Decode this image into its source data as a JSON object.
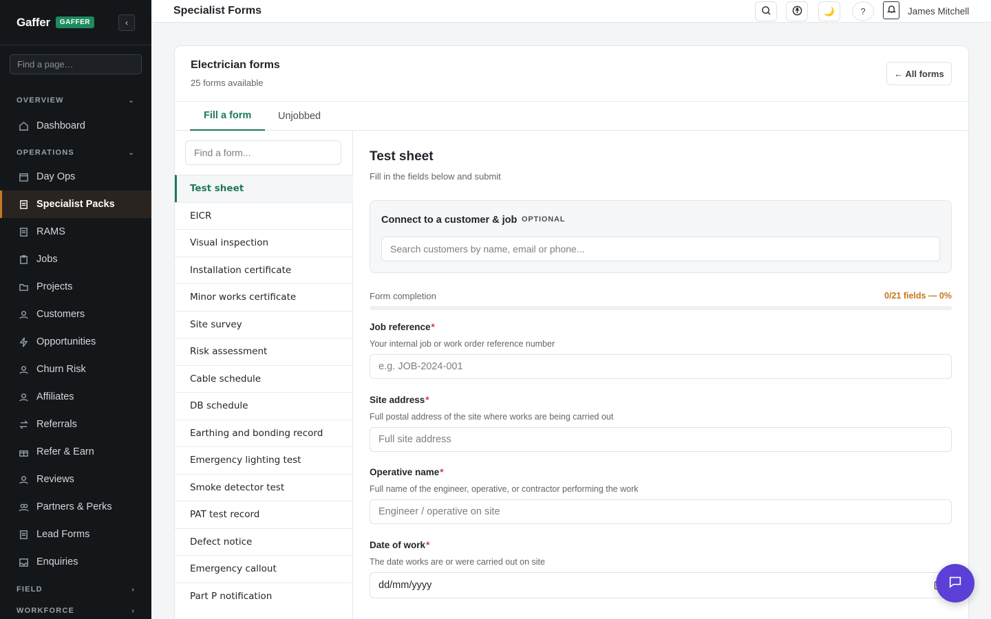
{
  "sidebar": {
    "brand": "Gaffer",
    "badge": "GAFFER",
    "collapse_label": "‹",
    "search_placeholder": "Find a page…",
    "sections": {
      "overview": "OVERVIEW",
      "operations": "OPERATIONS",
      "field": "FIELD",
      "workforce": "WORKFORCE"
    },
    "items": [
      {
        "label": "Dashboard",
        "icon": "home-icon"
      },
      {
        "label": "Day Ops",
        "icon": "calendar-icon"
      },
      {
        "label": "Specialist Packs",
        "icon": "document-icon"
      },
      {
        "label": "RAMS",
        "icon": "document-icon"
      },
      {
        "label": "Jobs",
        "icon": "clipboard-icon"
      },
      {
        "label": "Projects",
        "icon": "folder-icon"
      },
      {
        "label": "Customers",
        "icon": "users-icon"
      },
      {
        "label": "Opportunities",
        "icon": "bolt-icon"
      },
      {
        "label": "Churn Risk",
        "icon": "user-icon"
      },
      {
        "label": "Affiliates",
        "icon": "user-icon"
      },
      {
        "label": "Referrals",
        "icon": "arrows-icon"
      },
      {
        "label": "Refer & Earn",
        "icon": "gift-icon"
      },
      {
        "label": "Reviews",
        "icon": "user-icon"
      },
      {
        "label": "Partners & Perks",
        "icon": "users-icon"
      },
      {
        "label": "Lead Forms",
        "icon": "document-icon"
      },
      {
        "label": "Enquiries",
        "icon": "inbox-icon"
      }
    ]
  },
  "topbar": {
    "title": "Specialist Forms",
    "help_label": "?",
    "theme_label": "🌙",
    "user_name": "James Mitchell"
  },
  "card": {
    "title": "Electrician forms",
    "subtitle": "25 forms available",
    "all_forms_label": "← All forms",
    "tabs": [
      {
        "label": "Fill a form"
      },
      {
        "label": "Unjobbed"
      }
    ]
  },
  "form_list": {
    "search_placeholder": "Find a form...",
    "items": [
      "Test sheet",
      "EICR",
      "Visual inspection",
      "Installation certificate",
      "Minor works certificate",
      "Site survey",
      "Risk assessment",
      "Cable schedule",
      "DB schedule",
      "Earthing and bonding record",
      "Emergency lighting test",
      "Smoke detector test",
      "PAT test record",
      "Defect notice",
      "Emergency callout",
      "Part P notification"
    ]
  },
  "form": {
    "title": "Test sheet",
    "subtitle": "Fill in the fields below and submit",
    "connect": {
      "title": "Connect to a customer & job",
      "optional": "OPTIONAL",
      "placeholder": "Search customers by name, email or phone..."
    },
    "progress": {
      "label": "Form completion",
      "value_text": "0/21 fields — 0%",
      "fraction": 0
    },
    "fields": [
      {
        "label": "Job reference",
        "required": "*",
        "help": "Your internal job or work order reference number",
        "placeholder": "e.g. JOB-2024-001"
      },
      {
        "label": "Site address",
        "required": "*",
        "help": "Full postal address of the site where works are being carried out",
        "placeholder": "Full site address"
      },
      {
        "label": "Operative name",
        "required": "*",
        "help": "Full name of the engineer, operative, or contractor performing the work",
        "placeholder": "Engineer / operative on site"
      },
      {
        "label": "Date of work",
        "required": "*",
        "help": "The date works are or were carried out on site",
        "placeholder": "dd/mm/yyyy"
      }
    ]
  },
  "colors": {
    "sidebar_bg": "#14171a",
    "accent_green": "#1e7a56",
    "progress_orange": "#c8761a",
    "chat_purple": "#5b3fd6",
    "required_red": "#d23b3b"
  }
}
